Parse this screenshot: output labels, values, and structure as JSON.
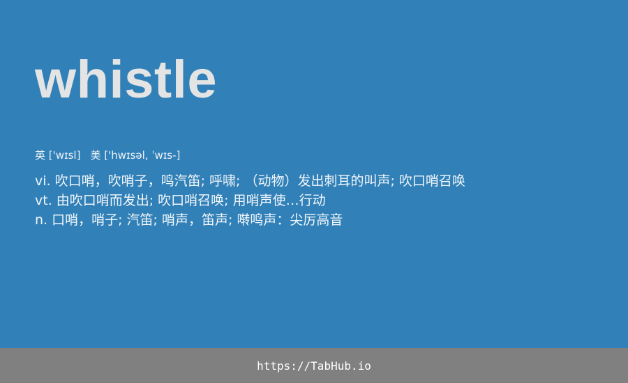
{
  "word": "whistle",
  "phonetics": {
    "uk_label": "英",
    "uk_ipa": "['wɪsl]",
    "us_label": "美",
    "us_ipa": "['hwɪsəl, ˈwɪs-]"
  },
  "definitions": [
    {
      "pos": "vi.",
      "text": "吹口哨，吹哨子，鸣汽笛; 呼啸; （动物）发出刺耳的叫声; 吹口哨召唤"
    },
    {
      "pos": "vt.",
      "text": "由吹口哨而发出; 吹口哨召唤; 用哨声使…行动"
    },
    {
      "pos": "n.",
      "text": "口哨，哨子; 汽笛; 哨声，笛声; 啭鸣声：尖厉高音"
    }
  ],
  "footer": {
    "link_text": "https://TabHub.io"
  },
  "colors": {
    "card_background": "#3181b8",
    "footer_background": "#808080",
    "word_text": "#e4e4e4"
  }
}
